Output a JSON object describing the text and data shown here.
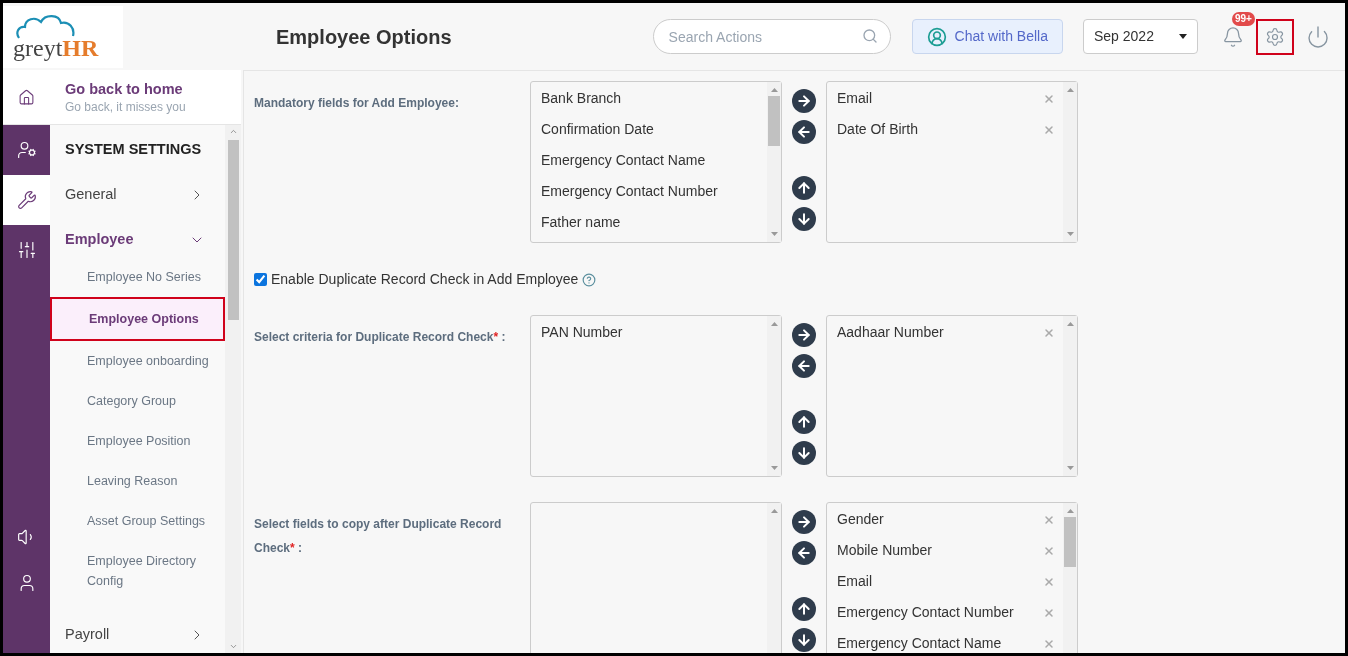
{
  "logo": {
    "part_1": "greyt",
    "part_2": "HR"
  },
  "header": {
    "title": "Employee Options",
    "search": {
      "placeholder": "Search Actions"
    },
    "chat_button": "Chat with Bella",
    "month_select": "Sep 2022",
    "notification_badge": "99+"
  },
  "home_link": {
    "title": "Go back to home",
    "subtitle": "Go back, it misses you"
  },
  "rail": {
    "items": [
      {
        "kind": "user-settings",
        "selected": false
      },
      {
        "kind": "wrench",
        "selected": true
      },
      {
        "kind": "sliders",
        "selected": false
      }
    ],
    "bottom_items": [
      {
        "kind": "speaker"
      },
      {
        "kind": "user"
      }
    ]
  },
  "sidebar": {
    "heading": "SYSTEM SETTINGS",
    "groups": [
      {
        "label": "General",
        "expanded": false
      },
      {
        "label": "Employee",
        "expanded": true,
        "children": [
          {
            "label": "Employee No Series",
            "selected": false
          },
          {
            "label": "Employee Options",
            "selected": true
          },
          {
            "label": "Employee onboarding",
            "selected": false
          },
          {
            "label": "Category Group",
            "selected": false
          },
          {
            "label": "Employee Position",
            "selected": false
          },
          {
            "label": "Leaving Reason",
            "selected": false
          },
          {
            "label": "Asset Group Settings",
            "selected": false
          },
          {
            "label": "Employee Directory Config",
            "selected": false
          }
        ]
      },
      {
        "label": "Payroll",
        "expanded": false
      }
    ]
  },
  "sections": [
    {
      "kind": "transfer",
      "label": "Mandatory fields for Add Employee:",
      "available": [
        "Bank Branch",
        "Confirmation Date",
        "Emergency Contact Name",
        "Emergency Contact Number",
        "Father name"
      ],
      "chosen": [
        "Email",
        "Date Of Birth"
      ]
    },
    {
      "kind": "checkbox",
      "label": "Enable Duplicate Record Check in Add Employee",
      "checked": true
    },
    {
      "kind": "transfer",
      "label": "Select criteria for Duplicate Record Check",
      "required_mark": "*",
      "suffix": ":",
      "available": [
        "PAN Number"
      ],
      "chosen": [
        "Aadhaar Number"
      ]
    },
    {
      "kind": "transfer",
      "label": "Select fields to copy after Duplicate Record Check",
      "required_mark": "*",
      "suffix": ":",
      "chosen": [
        "Gender",
        "Mobile Number",
        "Email",
        "Emergency Contact Number",
        "Emergency Contact Name"
      ]
    }
  ]
}
